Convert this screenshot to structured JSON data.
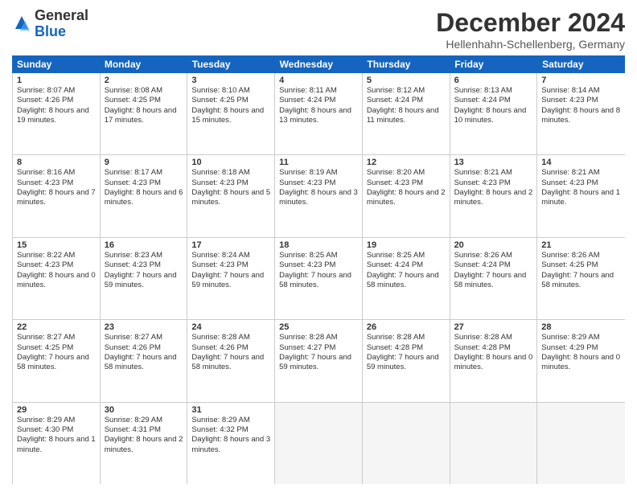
{
  "header": {
    "logo_general": "General",
    "logo_blue": "Blue",
    "month": "December 2024",
    "location": "Hellenhahn-Schellenberg, Germany"
  },
  "weekdays": [
    "Sunday",
    "Monday",
    "Tuesday",
    "Wednesday",
    "Thursday",
    "Friday",
    "Saturday"
  ],
  "weeks": [
    [
      {
        "day": "1",
        "sunrise": "Sunrise: 8:07 AM",
        "sunset": "Sunset: 4:26 PM",
        "daylight": "Daylight: 8 hours and 19 minutes."
      },
      {
        "day": "2",
        "sunrise": "Sunrise: 8:08 AM",
        "sunset": "Sunset: 4:25 PM",
        "daylight": "Daylight: 8 hours and 17 minutes."
      },
      {
        "day": "3",
        "sunrise": "Sunrise: 8:10 AM",
        "sunset": "Sunset: 4:25 PM",
        "daylight": "Daylight: 8 hours and 15 minutes."
      },
      {
        "day": "4",
        "sunrise": "Sunrise: 8:11 AM",
        "sunset": "Sunset: 4:24 PM",
        "daylight": "Daylight: 8 hours and 13 minutes."
      },
      {
        "day": "5",
        "sunrise": "Sunrise: 8:12 AM",
        "sunset": "Sunset: 4:24 PM",
        "daylight": "Daylight: 8 hours and 11 minutes."
      },
      {
        "day": "6",
        "sunrise": "Sunrise: 8:13 AM",
        "sunset": "Sunset: 4:24 PM",
        "daylight": "Daylight: 8 hours and 10 minutes."
      },
      {
        "day": "7",
        "sunrise": "Sunrise: 8:14 AM",
        "sunset": "Sunset: 4:23 PM",
        "daylight": "Daylight: 8 hours and 8 minutes."
      }
    ],
    [
      {
        "day": "8",
        "sunrise": "Sunrise: 8:16 AM",
        "sunset": "Sunset: 4:23 PM",
        "daylight": "Daylight: 8 hours and 7 minutes."
      },
      {
        "day": "9",
        "sunrise": "Sunrise: 8:17 AM",
        "sunset": "Sunset: 4:23 PM",
        "daylight": "Daylight: 8 hours and 6 minutes."
      },
      {
        "day": "10",
        "sunrise": "Sunrise: 8:18 AM",
        "sunset": "Sunset: 4:23 PM",
        "daylight": "Daylight: 8 hours and 5 minutes."
      },
      {
        "day": "11",
        "sunrise": "Sunrise: 8:19 AM",
        "sunset": "Sunset: 4:23 PM",
        "daylight": "Daylight: 8 hours and 3 minutes."
      },
      {
        "day": "12",
        "sunrise": "Sunrise: 8:20 AM",
        "sunset": "Sunset: 4:23 PM",
        "daylight": "Daylight: 8 hours and 2 minutes."
      },
      {
        "day": "13",
        "sunrise": "Sunrise: 8:21 AM",
        "sunset": "Sunset: 4:23 PM",
        "daylight": "Daylight: 8 hours and 2 minutes."
      },
      {
        "day": "14",
        "sunrise": "Sunrise: 8:21 AM",
        "sunset": "Sunset: 4:23 PM",
        "daylight": "Daylight: 8 hours and 1 minute."
      }
    ],
    [
      {
        "day": "15",
        "sunrise": "Sunrise: 8:22 AM",
        "sunset": "Sunset: 4:23 PM",
        "daylight": "Daylight: 8 hours and 0 minutes."
      },
      {
        "day": "16",
        "sunrise": "Sunrise: 8:23 AM",
        "sunset": "Sunset: 4:23 PM",
        "daylight": "Daylight: 7 hours and 59 minutes."
      },
      {
        "day": "17",
        "sunrise": "Sunrise: 8:24 AM",
        "sunset": "Sunset: 4:23 PM",
        "daylight": "Daylight: 7 hours and 59 minutes."
      },
      {
        "day": "18",
        "sunrise": "Sunrise: 8:25 AM",
        "sunset": "Sunset: 4:23 PM",
        "daylight": "Daylight: 7 hours and 58 minutes."
      },
      {
        "day": "19",
        "sunrise": "Sunrise: 8:25 AM",
        "sunset": "Sunset: 4:24 PM",
        "daylight": "Daylight: 7 hours and 58 minutes."
      },
      {
        "day": "20",
        "sunrise": "Sunrise: 8:26 AM",
        "sunset": "Sunset: 4:24 PM",
        "daylight": "Daylight: 7 hours and 58 minutes."
      },
      {
        "day": "21",
        "sunrise": "Sunrise: 8:26 AM",
        "sunset": "Sunset: 4:25 PM",
        "daylight": "Daylight: 7 hours and 58 minutes."
      }
    ],
    [
      {
        "day": "22",
        "sunrise": "Sunrise: 8:27 AM",
        "sunset": "Sunset: 4:25 PM",
        "daylight": "Daylight: 7 hours and 58 minutes."
      },
      {
        "day": "23",
        "sunrise": "Sunrise: 8:27 AM",
        "sunset": "Sunset: 4:26 PM",
        "daylight": "Daylight: 7 hours and 58 minutes."
      },
      {
        "day": "24",
        "sunrise": "Sunrise: 8:28 AM",
        "sunset": "Sunset: 4:26 PM",
        "daylight": "Daylight: 7 hours and 58 minutes."
      },
      {
        "day": "25",
        "sunrise": "Sunrise: 8:28 AM",
        "sunset": "Sunset: 4:27 PM",
        "daylight": "Daylight: 7 hours and 59 minutes."
      },
      {
        "day": "26",
        "sunrise": "Sunrise: 8:28 AM",
        "sunset": "Sunset: 4:28 PM",
        "daylight": "Daylight: 7 hours and 59 minutes."
      },
      {
        "day": "27",
        "sunrise": "Sunrise: 8:28 AM",
        "sunset": "Sunset: 4:28 PM",
        "daylight": "Daylight: 8 hours and 0 minutes."
      },
      {
        "day": "28",
        "sunrise": "Sunrise: 8:29 AM",
        "sunset": "Sunset: 4:29 PM",
        "daylight": "Daylight: 8 hours and 0 minutes."
      }
    ],
    [
      {
        "day": "29",
        "sunrise": "Sunrise: 8:29 AM",
        "sunset": "Sunset: 4:30 PM",
        "daylight": "Daylight: 8 hours and 1 minute."
      },
      {
        "day": "30",
        "sunrise": "Sunrise: 8:29 AM",
        "sunset": "Sunset: 4:31 PM",
        "daylight": "Daylight: 8 hours and 2 minutes."
      },
      {
        "day": "31",
        "sunrise": "Sunrise: 8:29 AM",
        "sunset": "Sunset: 4:32 PM",
        "daylight": "Daylight: 8 hours and 3 minutes."
      },
      null,
      null,
      null,
      null
    ]
  ]
}
